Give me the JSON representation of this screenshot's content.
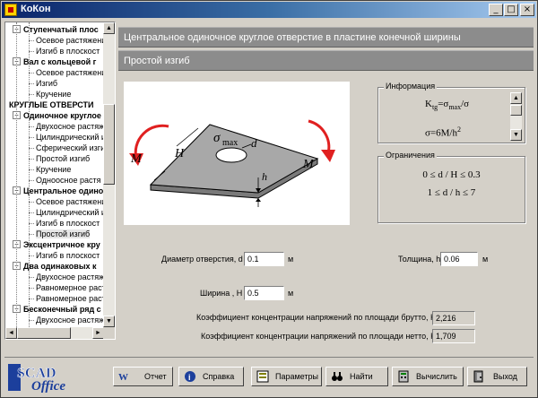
{
  "window": {
    "title": "КоКон"
  },
  "titlebar_buttons": {
    "minimize": "_",
    "maximize": "□",
    "close": "×"
  },
  "tree": {
    "items": [
      {
        "label": "Ступенчатый плос",
        "bold": true,
        "level": 1,
        "expander": "−"
      },
      {
        "label": "Осевое растяжени",
        "bold": false,
        "level": 2
      },
      {
        "label": "Изгиб в плоскост",
        "bold": false,
        "level": 2
      },
      {
        "label": "Вал с кольцевой г",
        "bold": true,
        "level": 1,
        "expander": "−"
      },
      {
        "label": "Осевое растяжени",
        "bold": false,
        "level": 2
      },
      {
        "label": "Изгиб",
        "bold": false,
        "level": 2
      },
      {
        "label": "Кручение",
        "bold": false,
        "level": 2
      },
      {
        "label": "КРУГЛЫЕ ОТВЕРСТИ",
        "bold": true,
        "level": 0
      },
      {
        "label": "Одиночное круглое",
        "bold": true,
        "level": 1,
        "expander": "−"
      },
      {
        "label": "Двухосное растяже",
        "bold": false,
        "level": 2
      },
      {
        "label": "Цилиндрический и",
        "bold": false,
        "level": 2
      },
      {
        "label": "Сферический изги",
        "bold": false,
        "level": 2
      },
      {
        "label": "Простой изгиб",
        "bold": false,
        "level": 2
      },
      {
        "label": "Кручение",
        "bold": false,
        "level": 2
      },
      {
        "label": "Одноосное растя",
        "bold": false,
        "level": 2
      },
      {
        "label": "Центральное одино",
        "bold": true,
        "level": 1,
        "expander": "−"
      },
      {
        "label": "Осевое растяжени",
        "bold": false,
        "level": 2
      },
      {
        "label": "Цилиндрический и",
        "bold": false,
        "level": 2
      },
      {
        "label": "Изгиб в плоскост",
        "bold": false,
        "level": 2
      },
      {
        "label": "Простой изгиб",
        "bold": false,
        "level": 2,
        "selected": true
      },
      {
        "label": "Эксцентричное кру",
        "bold": true,
        "level": 1,
        "expander": "−"
      },
      {
        "label": "Изгиб в плоскост",
        "bold": false,
        "level": 2
      },
      {
        "label": "Два одинаковых к",
        "bold": true,
        "level": 1,
        "expander": "−"
      },
      {
        "label": "Двухосное растяж",
        "bold": false,
        "level": 2
      },
      {
        "label": "Равномерное раст",
        "bold": false,
        "level": 2
      },
      {
        "label": "Равномерное раст",
        "bold": false,
        "level": 2
      },
      {
        "label": "Бесконечный ряд с",
        "bold": true,
        "level": 1,
        "expander": "−"
      },
      {
        "label": "Двухосное растяж",
        "bold": false,
        "level": 2
      }
    ],
    "scroll_arrows": {
      "up": "▲",
      "down": "▼",
      "left": "◄",
      "right": "►"
    },
    "vscroll_position": 0.35
  },
  "headers": {
    "title": "Центральное одиночное круглое отверстие в пластине конечной ширины",
    "subtitle": "Простой изгиб"
  },
  "diagram": {
    "M_left": "M",
    "M_right": "M",
    "H": "H",
    "sigma": "σ",
    "sigma_sub": "max",
    "d": "d",
    "h": "h"
  },
  "info": {
    "title": "Информация",
    "formula1_lhs": "K",
    "formula1_sub": "tg",
    "formula1_rhs": "=σ",
    "formula1_sub2": "max",
    "formula1_tail": "/σ",
    "formula2": "σ=6M/h",
    "formula2_sup": "2",
    "scroll_up": "▲",
    "scroll_down": "▼"
  },
  "limits": {
    "title": "Ограничения",
    "line1": "0 ≤ d / H ≤ 0.3",
    "line2": "1 ≤ d / h ≤ 7"
  },
  "inputs": {
    "diameter_label": "Диаметр отверстия, d",
    "diameter_value": "0.1",
    "diameter_unit": "м",
    "thickness_label": "Толщина, h",
    "thickness_value": "0.06",
    "thickness_unit": "м",
    "width_label": "Ширина , H",
    "width_value": "0.5",
    "width_unit": "м"
  },
  "results": {
    "gross_label": "Коэффициент концентрации напряжений по площади брутто, K",
    "gross_sub": "tg",
    "gross_value": "2,216",
    "net_label": "Коэффициент концентрации напряжений по площади нетто, K",
    "net_sub": "tn",
    "net_value": "1,709"
  },
  "logo": {
    "line1": "SCAD",
    "line2": "Office"
  },
  "buttons": {
    "report": "Отчет",
    "help": "Справка",
    "params": "Параметры",
    "find": "Найти",
    "calc": "Вычислить",
    "exit": "Выход"
  },
  "colors": {
    "accent_title": "#0a246a",
    "header_gray": "#8c8c8c",
    "plate_gray": "#a8a8a8",
    "arrow_red": "#e02020"
  }
}
